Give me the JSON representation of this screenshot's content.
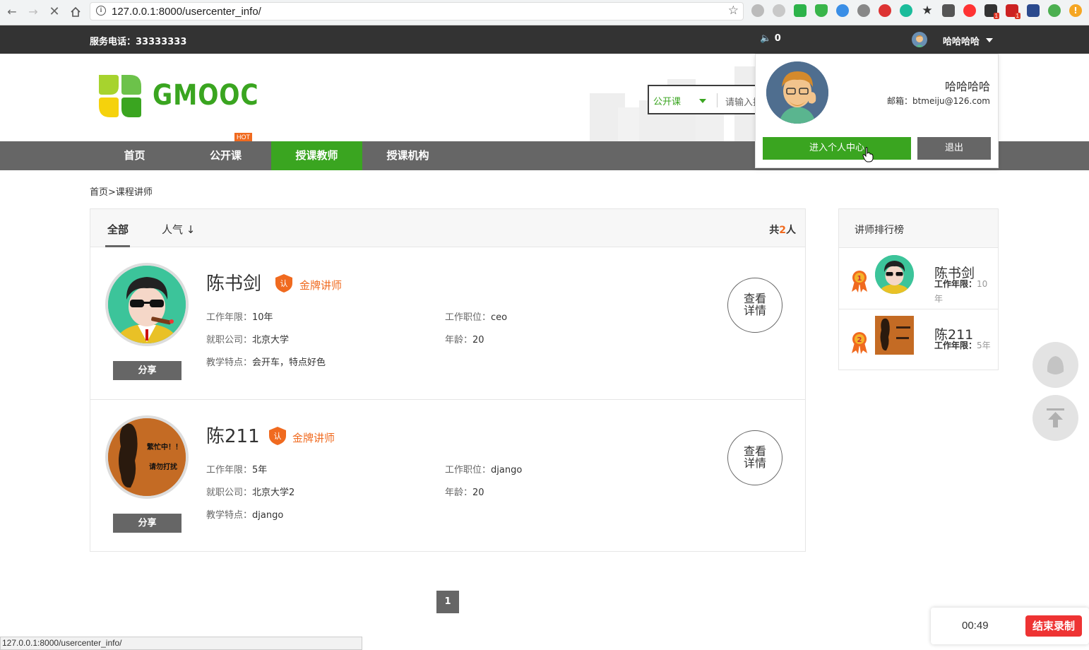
{
  "browser": {
    "url": "127.0.0.1:8000/usercenter_info/",
    "status_url": "127.0.0.1:8000/usercenter_info/"
  },
  "topbar": {
    "phone": "服务电话：33333333",
    "message_count": "0",
    "username": "哈哈哈哈"
  },
  "header": {
    "logo_text": "GMOOC",
    "search_category": "公开课",
    "search_placeholder": "请输入搜"
  },
  "nav": {
    "items": [
      {
        "label": "首页"
      },
      {
        "label": "公开课"
      },
      {
        "label": "授课教师"
      },
      {
        "label": "授课机构"
      }
    ],
    "active_index": 2,
    "hot_label": "HOT"
  },
  "breadcrumb": {
    "home": "首页",
    "sep": ">",
    "current": "课程讲师"
  },
  "list": {
    "tabs": [
      {
        "label": "全部"
      },
      {
        "label": "人气 ↓"
      }
    ],
    "total_prefix": "共",
    "total_count": "2",
    "total_suffix": "人",
    "share_label": "分享",
    "detail_line1": "查看",
    "detail_line2": "详情",
    "teachers": [
      {
        "name": "陈书剑",
        "badge": "金牌讲师",
        "work_years_label": "工作年限：",
        "work_years": "10年",
        "position_label": "工作职位：",
        "position": "ceo",
        "company_label": "就职公司：",
        "company": "北京大学",
        "age_label": "年龄：",
        "age": "20",
        "feature_label": "教学特点：",
        "feature": "会开车，特点好色"
      },
      {
        "name": "陈211",
        "badge": "金牌讲师",
        "work_years_label": "工作年限：",
        "work_years": "5年",
        "position_label": "工作职位：",
        "position": "django",
        "company_label": "就职公司：",
        "company": "北京大学2",
        "age_label": "年龄：",
        "age": "20",
        "feature_label": "教学特点：",
        "feature": "django"
      }
    ]
  },
  "pagination": {
    "current": "1"
  },
  "ranking": {
    "title": "讲师排行榜",
    "items": [
      {
        "rank": "1",
        "name": "陈书剑",
        "years_label": "工作年限：",
        "years": "10年"
      },
      {
        "rank": "2",
        "name": "陈211",
        "years_label": "工作年限：",
        "years": "5年"
      }
    ]
  },
  "avatar_text": {
    "line1": "繁忙中！！",
    "line2": "请勿打扰"
  },
  "dropdown": {
    "name": "哈哈哈哈",
    "email": "邮箱：btmeiju@126.com",
    "enter_label": "进入个人中心",
    "logout_label": "退出"
  },
  "recording": {
    "time": "00:49",
    "stop_label": "结束录制"
  },
  "colors": {
    "brand_green": "#3aa520",
    "accent_orange": "#f06a1f",
    "nav_gray": "#666666",
    "topbar": "#333333"
  }
}
